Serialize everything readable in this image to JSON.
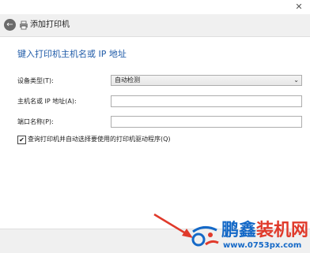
{
  "window": {
    "close_glyph": "✕"
  },
  "nav": {
    "title": "添加打印机",
    "back_icon": "back-arrow-icon",
    "printer_icon": "printer-icon"
  },
  "main": {
    "heading": "键入打印机主机名或 IP 地址",
    "device_type": {
      "label": "设备类型(T):",
      "value": "自动检测"
    },
    "hostname": {
      "label": "主机名或 IP 地址(A):",
      "value": ""
    },
    "port_name": {
      "label": "端口名称(P):",
      "value": ""
    },
    "query_printer": {
      "label": "查询打印机并自动选择要使用的打印机驱动程序(Q)",
      "checked": true,
      "glyph": "✔"
    }
  },
  "watermark": {
    "brand_a": "鹏鑫",
    "brand_b": "装机网",
    "url": "www.0753px.com"
  },
  "colors": {
    "heading": "#1f5ba8",
    "nav_bg": "#f0f0f0",
    "arrow": "#e03a2b",
    "brand_blue": "#1569c7",
    "brand_red": "#e03a2b"
  }
}
